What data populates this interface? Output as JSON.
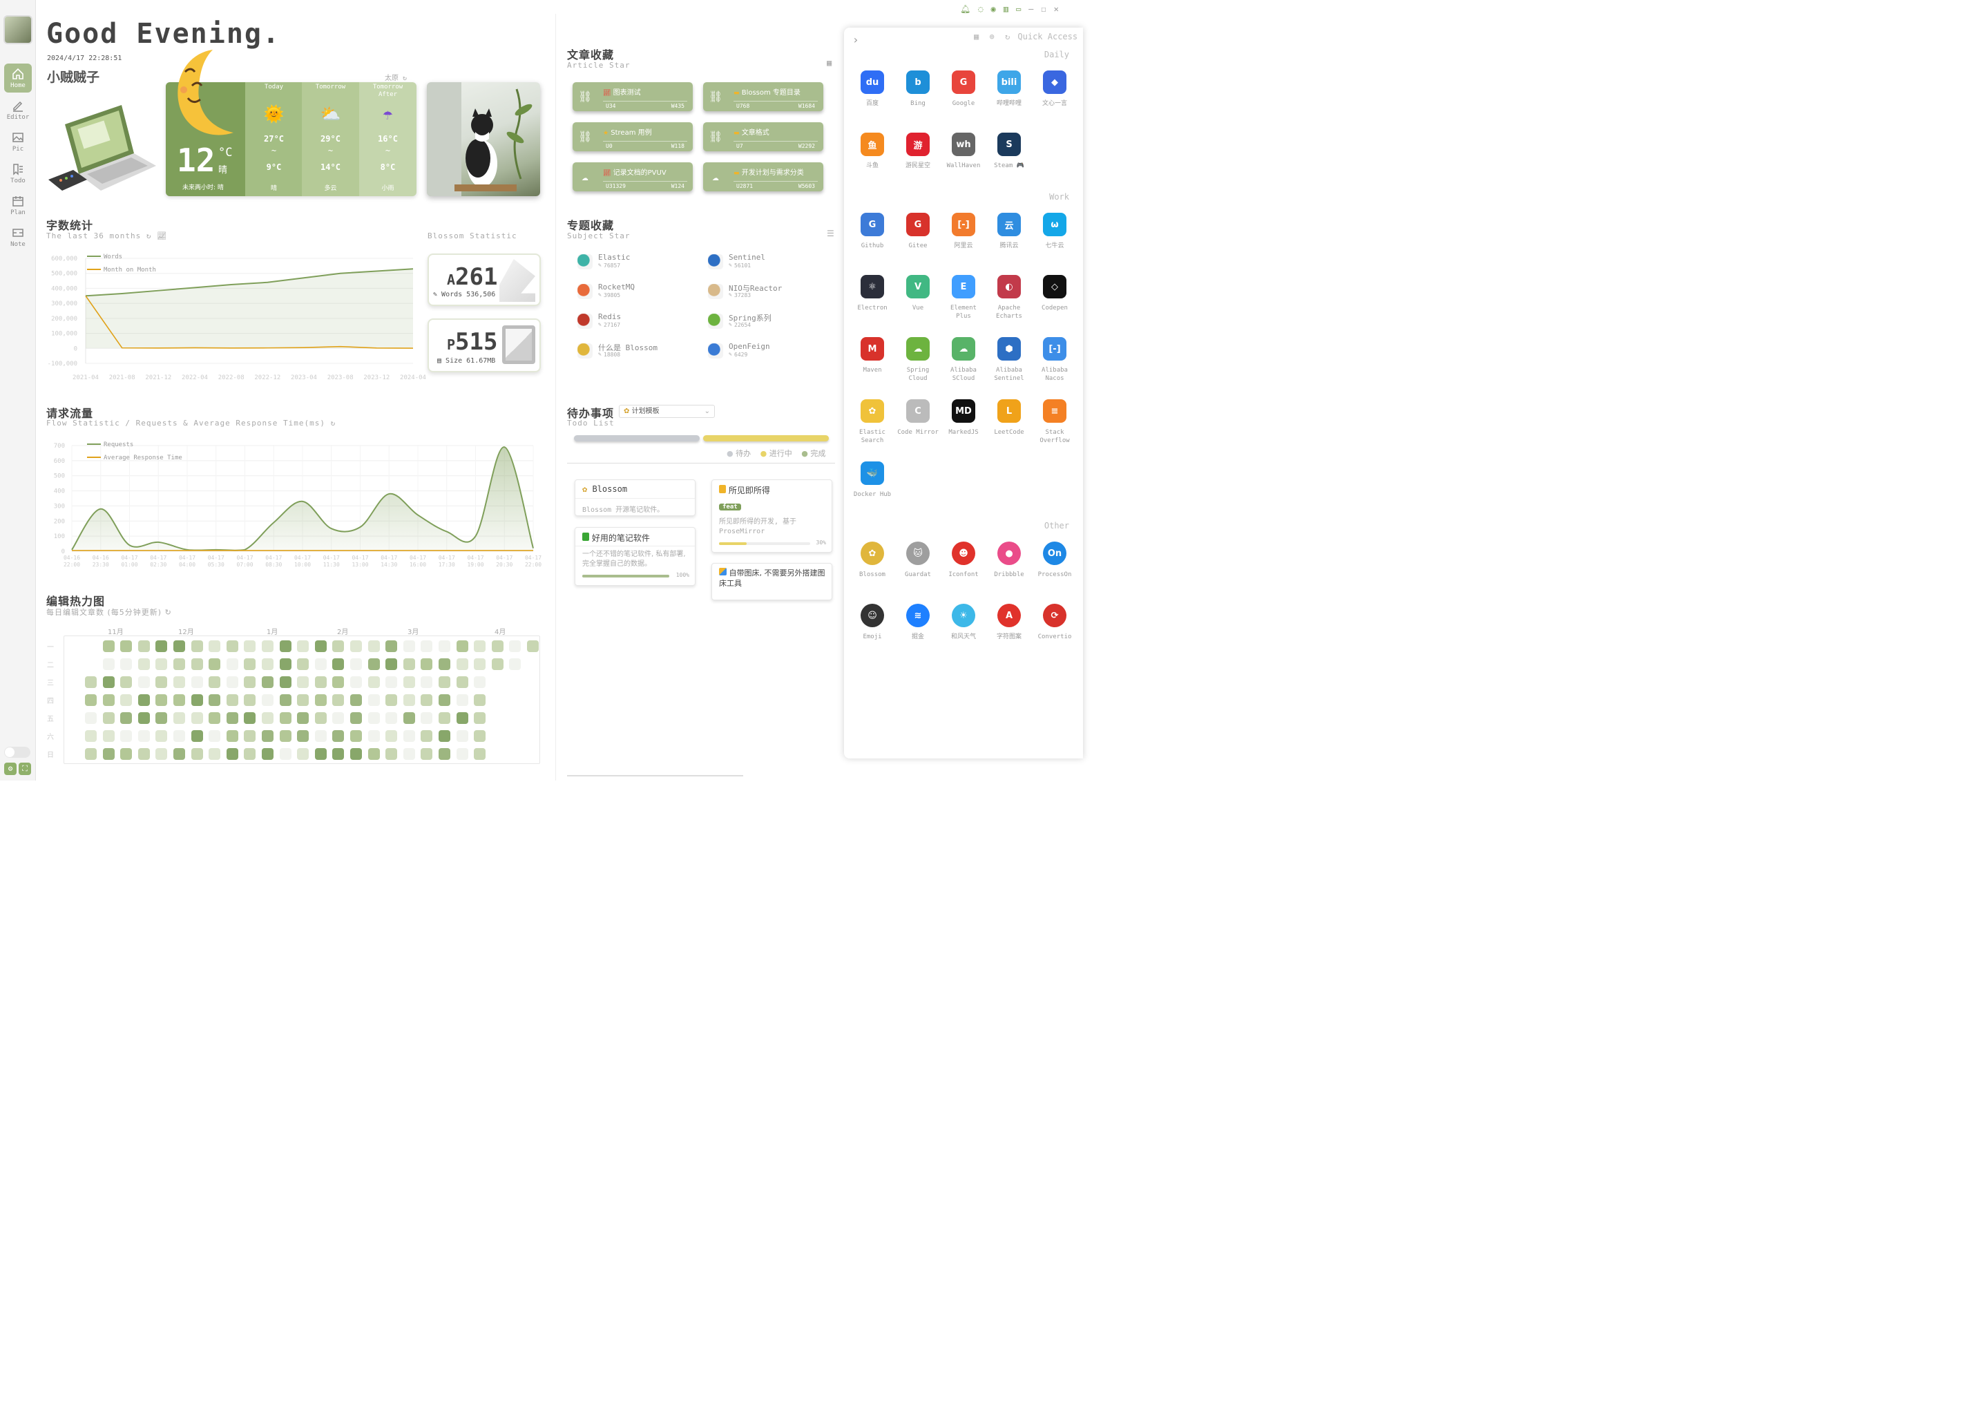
{
  "greeting": "Good Evening.",
  "datetime": "2024/4/17 22:28:51",
  "username": "小贼贼子",
  "sidebar": {
    "items": [
      {
        "label": "Home",
        "icon": "home-icon"
      },
      {
        "label": "Editor",
        "icon": "editor-icon"
      },
      {
        "label": "Pic",
        "icon": "picture-icon"
      },
      {
        "label": "Todo",
        "icon": "todo-icon"
      },
      {
        "label": "Plan",
        "icon": "calendar-icon"
      },
      {
        "label": "Note",
        "icon": "note-icon"
      }
    ]
  },
  "weather": {
    "source": "太原",
    "temp": "12",
    "unit": "°C",
    "cond": "晴",
    "forecast_text": "未来两小时: 晴",
    "days": [
      {
        "label": "Today",
        "high": "27°C",
        "sep": "~",
        "low": "9°C",
        "cond": "晴",
        "icon": "sunny-icon"
      },
      {
        "label": "Tomorrow",
        "high": "29°C",
        "sep": "~",
        "low": "14°C",
        "cond": "多云",
        "icon": "cloudy-icon"
      },
      {
        "label": "Tomorrow After",
        "high": "16°C",
        "sep": "~",
        "low": "8°C",
        "cond": "小雨",
        "icon": "rain-icon"
      }
    ]
  },
  "articles": {
    "title": "文章收藏",
    "subtitle": "Article Star",
    "items": [
      {
        "title": "图表测试",
        "u": "U34",
        "w": "W435",
        "icon": "link-icon",
        "badge": "chart-icon"
      },
      {
        "title": "Blossom 专题目录",
        "u": "U768",
        "w": "W1684",
        "icon": "link-icon",
        "badge": "folder-icon"
      },
      {
        "title": "Stream 用例",
        "u": "U0",
        "w": "W118",
        "icon": "link-icon",
        "badge": "star-icon"
      },
      {
        "title": "文章格式",
        "u": "U7",
        "w": "W2292",
        "icon": "link-icon",
        "badge": "folder-icon"
      },
      {
        "title": "记录文档的PVUV",
        "u": "U31329",
        "w": "W124",
        "icon": "cloud-icon",
        "badge": "chart-icon"
      },
      {
        "title": "开发计划与需求分类",
        "u": "U2871",
        "w": "W5603",
        "icon": "cloud-icon",
        "badge": "folder-icon"
      }
    ]
  },
  "subjects": {
    "title": "专题收藏",
    "subtitle": "Subject Star",
    "items": [
      {
        "name": "Elastic",
        "count": "76857",
        "color": "#3eb3a7"
      },
      {
        "name": "Sentinel",
        "count": "56101",
        "color": "#2d6fc4"
      },
      {
        "name": "RocketMQ",
        "count": "39805",
        "color": "#e86a3a"
      },
      {
        "name": "NIO与Reactor",
        "count": "37283",
        "color": "#d8b98a"
      },
      {
        "name": "Redis",
        "count": "27167",
        "color": "#c0392b"
      },
      {
        "name": "Spring系列",
        "count": "22654",
        "color": "#6db33f"
      },
      {
        "name": "什么是 Blossom",
        "count": "18808",
        "color": "#e0b63c"
      },
      {
        "name": "OpenFeign",
        "count": "6429",
        "color": "#3a7bd5"
      }
    ]
  },
  "word_stats": {
    "title": "字数统计",
    "subtitle": "The last 36 months",
    "blossom_label": "Blossom Statistic",
    "articles_prefix": "A",
    "articles_count": "261",
    "words_label": "Words 536,506",
    "pics_prefix": "P",
    "pics_count": "515",
    "size_label": "Size 61.67MB"
  },
  "chart_data": [
    {
      "type": "line",
      "title": "",
      "x": [
        "2021-04",
        "2021-08",
        "2021-12",
        "2022-04",
        "2022-08",
        "2022-12",
        "2023-04",
        "2023-08",
        "2023-12",
        "2024-04"
      ],
      "series": [
        {
          "name": "Words",
          "values": [
            350000,
            365000,
            385000,
            405000,
            425000,
            440000,
            470000,
            500000,
            515000,
            530000
          ]
        },
        {
          "name": "Month on Month",
          "values": [
            350000,
            3000,
            2000,
            4000,
            2000,
            3000,
            5000,
            12000,
            2000,
            1000
          ]
        }
      ],
      "ylim": [
        -100000,
        600000
      ],
      "yticks": [
        "600,000",
        "500,000",
        "400,000",
        "300,000",
        "200,000",
        "100,000",
        "0",
        "-100,000"
      ]
    },
    {
      "type": "line",
      "title": "请求流量",
      "subtitle": "Flow Statistic / Requests & Average Response Time(ms)",
      "x": [
        "04-16 22:00",
        "04-16 23:30",
        "04-17 01:00",
        "04-17 02:30",
        "04-17 04:00",
        "04-17 05:30",
        "04-17 07:00",
        "04-17 08:30",
        "04-17 10:00",
        "04-17 11:30",
        "04-17 13:00",
        "04-17 14:30",
        "04-17 16:00",
        "04-17 17:30",
        "04-17 19:00",
        "04-17 20:30",
        "04-17 22:00"
      ],
      "series": [
        {
          "name": "Requests",
          "values": [
            10,
            280,
            40,
            60,
            10,
            10,
            10,
            190,
            330,
            150,
            160,
            380,
            240,
            130,
            100,
            690,
            20
          ]
        },
        {
          "name": "Average Response Time",
          "values": [
            5,
            5,
            5,
            5,
            5,
            5,
            5,
            5,
            5,
            5,
            5,
            5,
            5,
            5,
            5,
            5,
            5
          ]
        }
      ],
      "ylim": [
        0,
        700
      ],
      "yticks": [
        "700",
        "600",
        "500",
        "400",
        "300",
        "200",
        "100",
        "0"
      ]
    }
  ],
  "heatmap": {
    "title": "编辑热力图",
    "subtitle": "每日编辑文章数 (每5分钟更新)",
    "months": [
      "11月",
      "12月",
      "1月",
      "2月",
      "3月",
      "4月"
    ],
    "weekdays": [
      "一",
      "二",
      "三",
      "四",
      "五",
      "六",
      "日"
    ]
  },
  "todo": {
    "title": "待办事项",
    "subtitle": "Todo List",
    "select": "计划模板",
    "legend": [
      "待办",
      "进行中",
      "完成"
    ],
    "cards": [
      {
        "title": "Blossom",
        "body": "Blossom 开源笔记软件。"
      },
      {
        "title": "所见即所得",
        "tag": "feat",
        "body": "所见即所得的开发, 基于 ProseMirror",
        "progress": "30%"
      },
      {
        "title": "好用的笔记软件",
        "body": "一个还不错的笔记软件, 私有部署, 完全掌握自己的数据。",
        "progress": "100%"
      },
      {
        "title": "自带图床, 不需要另外搭建图床工具"
      }
    ]
  },
  "quick_access": {
    "title": "Quick Access",
    "groups": [
      {
        "name": "Daily",
        "items": [
          {
            "label": "百度",
            "color": "#2f6ef5",
            "glyph": "du"
          },
          {
            "label": "Bing",
            "color": "#1e8fd8",
            "glyph": "b"
          },
          {
            "label": "Google",
            "color": "#e8453c",
            "glyph": "G"
          },
          {
            "label": "哔哩哔哩",
            "color": "#3ea6e8",
            "glyph": "bili"
          },
          {
            "label": "文心一言",
            "color": "#3a67e0",
            "glyph": "◆"
          },
          {
            "label": "斗鱼",
            "color": "#f58a1f",
            "glyph": "鱼"
          },
          {
            "label": "游民星空",
            "color": "#e0222f",
            "glyph": "游"
          },
          {
            "label": "WallHaven",
            "color": "#666666",
            "glyph": "wh"
          },
          {
            "label": "Steam 🎮",
            "color": "#1b3a5c",
            "glyph": "S"
          }
        ]
      },
      {
        "name": "Work",
        "items": [
          {
            "label": "Github",
            "color": "#3d7bd8",
            "glyph": "G"
          },
          {
            "label": "Gitee",
            "color": "#d8322b",
            "glyph": "G"
          },
          {
            "label": "阿里云",
            "color": "#f27b2d",
            "glyph": "[-]"
          },
          {
            "label": "腾讯云",
            "color": "#2f8de0",
            "glyph": "云"
          },
          {
            "label": "七牛云",
            "color": "#14a7e8",
            "glyph": "ω"
          },
          {
            "label": "Electron",
            "color": "#2b2e3a",
            "glyph": "⚛"
          },
          {
            "label": "Vue",
            "color": "#41b883",
            "glyph": "V"
          },
          {
            "label": "Element Plus",
            "color": "#409eff",
            "glyph": "E"
          },
          {
            "label": "Apache Echarts",
            "color": "#c23a4a",
            "glyph": "◐"
          },
          {
            "label": "Codepen",
            "color": "#111111",
            "glyph": "◇"
          },
          {
            "label": "Maven",
            "color": "#d8322b",
            "glyph": "M"
          },
          {
            "label": "Spring Cloud",
            "color": "#6db33f",
            "glyph": "☁"
          },
          {
            "label": "Alibaba SCloud",
            "color": "#58b368",
            "glyph": "☁"
          },
          {
            "label": "Alibaba Sentinel",
            "color": "#2d6fc4",
            "glyph": "⬢"
          },
          {
            "label": "Alibaba Nacos",
            "color": "#3d8ee8",
            "glyph": "[-]"
          },
          {
            "label": "Elastic Search",
            "color": "#f0c23a",
            "glyph": "✿"
          },
          {
            "label": "Code Mirror",
            "color": "#bbbbbb",
            "glyph": "C"
          },
          {
            "label": "MarkedJS",
            "color": "#111111",
            "glyph": "MD"
          },
          {
            "label": "LeetCode",
            "color": "#f0a21a",
            "glyph": "L"
          },
          {
            "label": "Stack Overflow",
            "color": "#f48024",
            "glyph": "≡"
          },
          {
            "label": "Docker Hub",
            "color": "#1d91e6",
            "glyph": "🐳"
          }
        ]
      },
      {
        "name": "Other",
        "items": [
          {
            "label": "Blossom",
            "color": "#e0b63c",
            "glyph": "✿"
          },
          {
            "label": "Guardat",
            "color": "#9e9e9e",
            "glyph": "🐱"
          },
          {
            "label": "Iconfont",
            "color": "#e0322b",
            "glyph": "☻"
          },
          {
            "label": "Dribbble",
            "color": "#ea4c89",
            "glyph": "●"
          },
          {
            "label": "ProcessOn",
            "color": "#1e88e5",
            "glyph": "On"
          },
          {
            "label": "Emoji",
            "color": "#333333",
            "glyph": "☺"
          },
          {
            "label": "掘金",
            "color": "#1e80ff",
            "glyph": "≋"
          },
          {
            "label": "和风天气",
            "color": "#3db8e8",
            "glyph": "☀"
          },
          {
            "label": "字符图案",
            "color": "#e0322b",
            "glyph": "A"
          },
          {
            "label": "Convertio",
            "color": "#d8322b",
            "glyph": "⟳"
          }
        ]
      }
    ]
  }
}
